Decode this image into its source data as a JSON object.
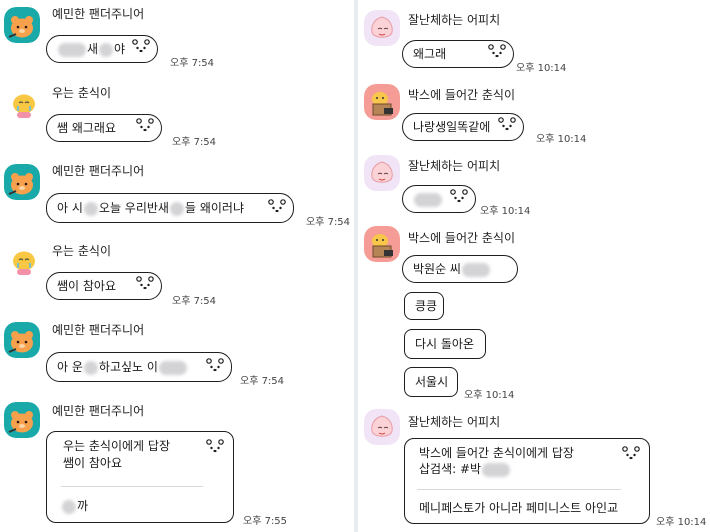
{
  "left": {
    "messages": [
      {
        "sender": "예민한 팬더주니어",
        "avatar": "panda-icon",
        "text_before": "",
        "text_mid": "새",
        "text_after": "야",
        "time": "오후 7:54"
      },
      {
        "sender": "우는 춘식이",
        "avatar": "crying-choonsik-icon",
        "text": "쌤 왜그래요",
        "time": "오후 7:54"
      },
      {
        "sender": "예민한 팬더주니어",
        "avatar": "panda-icon",
        "text_a": "아 시",
        "text_b": "오늘 우리반새",
        "text_c": "들 왜이러냐",
        "time": "오후 7:54"
      },
      {
        "sender": "우는 춘식이",
        "avatar": "crying-choonsik-icon",
        "text": "쌤이 참아요",
        "time": "오후 7:54"
      },
      {
        "sender": "예민한 팬더주니어",
        "avatar": "panda-icon",
        "text_a": "아 운",
        "text_b": "하고싶노 이",
        "time": "오후 7:54"
      },
      {
        "sender": "예민한 팬더주니어",
        "avatar": "panda-icon",
        "reply_to": "우는 춘식이에게 답장",
        "quoted": "쌤이 참아요",
        "text_after": "까",
        "time": "오후 7:55"
      }
    ]
  },
  "right": {
    "messages": [
      {
        "sender": "잘난체하는 어피치",
        "avatar": "apeach-icon",
        "text": "왜그래",
        "time": "오후 10:14"
      },
      {
        "sender": "박스에 들어간 춘식이",
        "avatar": "box-choonsik-icon",
        "text": "나랑생일똑같에",
        "time": "오후 10:14"
      },
      {
        "sender": "잘난체하는 어피치",
        "avatar": "apeach-icon",
        "text": "",
        "time": "오후 10:14"
      },
      {
        "sender": "박스에 들어간 춘식이",
        "avatar": "box-choonsik-icon",
        "texts": [
          "박원순 씨",
          "킁킁",
          "다시 돌아온",
          "서울시"
        ],
        "time": "오후 10:14"
      },
      {
        "sender": "잘난체하는 어피치",
        "avatar": "apeach-icon",
        "reply_to": "박스에 들어간 춘식이에게 답장",
        "quoted": "삽검색: #박",
        "text": "메니페스토가 아니라 페미니스트 아인교",
        "time": "오후 10:14"
      }
    ]
  }
}
